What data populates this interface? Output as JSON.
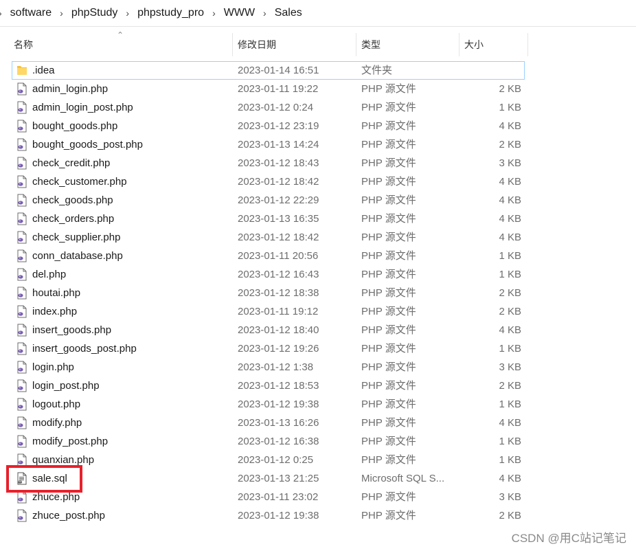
{
  "breadcrumb": {
    "items": [
      "software",
      "phpStudy",
      "phpstudy_pro",
      "WWW",
      "Sales"
    ],
    "separator": "›"
  },
  "columns": {
    "name": "名称",
    "date": "修改日期",
    "type": "类型",
    "size": "大小"
  },
  "files": [
    {
      "name": ".idea",
      "date": "2023-01-14 16:51",
      "type": "文件夹",
      "size": "",
      "icon": "folder-icon"
    },
    {
      "name": "admin_login.php",
      "date": "2023-01-11 19:22",
      "type": "PHP 源文件",
      "size": "2 KB",
      "icon": "php-file-icon"
    },
    {
      "name": "admin_login_post.php",
      "date": "2023-01-12 0:24",
      "type": "PHP 源文件",
      "size": "1 KB",
      "icon": "php-file-icon"
    },
    {
      "name": "bought_goods.php",
      "date": "2023-01-12 23:19",
      "type": "PHP 源文件",
      "size": "4 KB",
      "icon": "php-file-icon"
    },
    {
      "name": "bought_goods_post.php",
      "date": "2023-01-13 14:24",
      "type": "PHP 源文件",
      "size": "2 KB",
      "icon": "php-file-icon"
    },
    {
      "name": "check_credit.php",
      "date": "2023-01-12 18:43",
      "type": "PHP 源文件",
      "size": "3 KB",
      "icon": "php-file-icon"
    },
    {
      "name": "check_customer.php",
      "date": "2023-01-12 18:42",
      "type": "PHP 源文件",
      "size": "4 KB",
      "icon": "php-file-icon"
    },
    {
      "name": "check_goods.php",
      "date": "2023-01-12 22:29",
      "type": "PHP 源文件",
      "size": "4 KB",
      "icon": "php-file-icon"
    },
    {
      "name": "check_orders.php",
      "date": "2023-01-13 16:35",
      "type": "PHP 源文件",
      "size": "4 KB",
      "icon": "php-file-icon"
    },
    {
      "name": "check_supplier.php",
      "date": "2023-01-12 18:42",
      "type": "PHP 源文件",
      "size": "4 KB",
      "icon": "php-file-icon"
    },
    {
      "name": "conn_database.php",
      "date": "2023-01-11 20:56",
      "type": "PHP 源文件",
      "size": "1 KB",
      "icon": "php-file-icon"
    },
    {
      "name": "del.php",
      "date": "2023-01-12 16:43",
      "type": "PHP 源文件",
      "size": "1 KB",
      "icon": "php-file-icon"
    },
    {
      "name": "houtai.php",
      "date": "2023-01-12 18:38",
      "type": "PHP 源文件",
      "size": "2 KB",
      "icon": "php-file-icon"
    },
    {
      "name": "index.php",
      "date": "2023-01-11 19:12",
      "type": "PHP 源文件",
      "size": "2 KB",
      "icon": "php-file-icon"
    },
    {
      "name": "insert_goods.php",
      "date": "2023-01-12 18:40",
      "type": "PHP 源文件",
      "size": "4 KB",
      "icon": "php-file-icon"
    },
    {
      "name": "insert_goods_post.php",
      "date": "2023-01-12 19:26",
      "type": "PHP 源文件",
      "size": "1 KB",
      "icon": "php-file-icon"
    },
    {
      "name": "login.php",
      "date": "2023-01-12 1:38",
      "type": "PHP 源文件",
      "size": "3 KB",
      "icon": "php-file-icon"
    },
    {
      "name": "login_post.php",
      "date": "2023-01-12 18:53",
      "type": "PHP 源文件",
      "size": "2 KB",
      "icon": "php-file-icon"
    },
    {
      "name": "logout.php",
      "date": "2023-01-12 19:38",
      "type": "PHP 源文件",
      "size": "1 KB",
      "icon": "php-file-icon"
    },
    {
      "name": "modify.php",
      "date": "2023-01-13 16:26",
      "type": "PHP 源文件",
      "size": "4 KB",
      "icon": "php-file-icon"
    },
    {
      "name": "modify_post.php",
      "date": "2023-01-12 16:38",
      "type": "PHP 源文件",
      "size": "1 KB",
      "icon": "php-file-icon"
    },
    {
      "name": "quanxian.php",
      "date": "2023-01-12 0:25",
      "type": "PHP 源文件",
      "size": "1 KB",
      "icon": "php-file-icon"
    },
    {
      "name": "sale.sql",
      "date": "2023-01-13 21:25",
      "type": "Microsoft SQL S...",
      "size": "4 KB",
      "icon": "sql-file-icon"
    },
    {
      "name": "zhuce.php",
      "date": "2023-01-11 23:02",
      "type": "PHP 源文件",
      "size": "3 KB",
      "icon": "php-file-icon"
    },
    {
      "name": "zhuce_post.php",
      "date": "2023-01-12 19:38",
      "type": "PHP 源文件",
      "size": "2 KB",
      "icon": "php-file-icon"
    }
  ],
  "selected_index": 0,
  "highlighted_index": 22,
  "watermark": "CSDN @用C站记笔记",
  "colors": {
    "highlight": "#e8202a",
    "selection_border": "#99d1ff",
    "folder": "#f5c342",
    "php_icon": "#7a5fb5"
  }
}
